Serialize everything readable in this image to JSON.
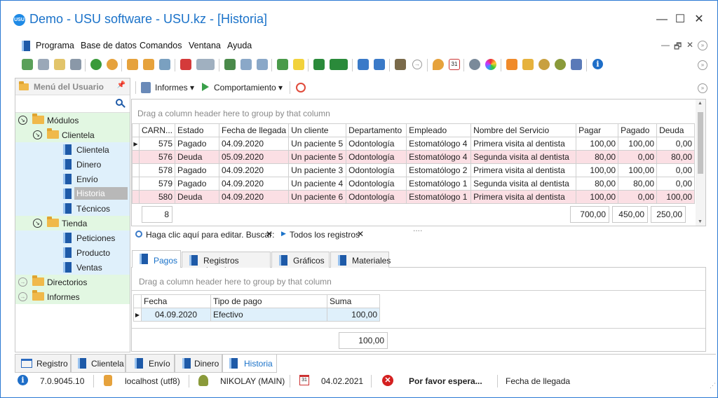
{
  "window": {
    "title": "Demo - USU software - USU.kz - [Historia]",
    "logo_text": "USU",
    "minimize": "—",
    "maximize": "☐",
    "close": "✕"
  },
  "menu": {
    "items": [
      "Programa",
      "Base de datos",
      "Comandos",
      "Ventana",
      "Ayuda"
    ],
    "mdi_controls": [
      "—",
      "🗗",
      "✕"
    ]
  },
  "sidebar": {
    "title": "Menú del Usuario",
    "pin": "📌",
    "tree": [
      {
        "label": "Módulos",
        "level": 0,
        "type": "folder-open"
      },
      {
        "label": "Clientela",
        "level": 1,
        "type": "folder-open"
      },
      {
        "label": "Clientela",
        "level": 2,
        "type": "doc"
      },
      {
        "label": "Dinero",
        "level": 2,
        "type": "doc"
      },
      {
        "label": "Envío",
        "level": 2,
        "type": "doc"
      },
      {
        "label": "Historia",
        "level": 2,
        "type": "doc",
        "selected": true
      },
      {
        "label": "Técnicos",
        "level": 2,
        "type": "doc"
      },
      {
        "label": "Tienda",
        "level": 1,
        "type": "folder-open"
      },
      {
        "label": "Peticiones",
        "level": 2,
        "type": "doc"
      },
      {
        "label": "Producto",
        "level": 2,
        "type": "doc"
      },
      {
        "label": "Ventas",
        "level": 2,
        "type": "doc"
      },
      {
        "label": "Directorios",
        "level": 0,
        "type": "folder"
      },
      {
        "label": "Informes",
        "level": 0,
        "type": "folder"
      }
    ]
  },
  "subtoolbar": {
    "informes": "Informes",
    "comportamiento": "Comportamiento"
  },
  "grid": {
    "group_hint": "Drag a column header here to group by that column",
    "columns": [
      "CARN...",
      "Estado",
      "Fecha de llegada",
      "Un cliente",
      "Departamento",
      "Empleado",
      "Nombre del Servicio",
      "Pagar",
      "Pagado",
      "Deuda"
    ],
    "rows": [
      {
        "carn": "575",
        "estado": "Pagado",
        "fecha": "04.09.2020",
        "cliente": "Un paciente 5",
        "depto": "Odontología",
        "empleado": "Estomatólogo 4",
        "servicio": "Primera visita al dentista",
        "pagar": "100,00",
        "pagado": "100,00",
        "deuda": "0,00",
        "status": "paid"
      },
      {
        "carn": "576",
        "estado": "Deuda",
        "fecha": "05.09.2020",
        "cliente": "Un paciente 5",
        "depto": "Odontología",
        "empleado": "Estomatólogo 4",
        "servicio": "Segunda visita al dentista",
        "pagar": "80,00",
        "pagado": "0,00",
        "deuda": "80,00",
        "status": "debt"
      },
      {
        "carn": "578",
        "estado": "Pagado",
        "fecha": "04.09.2020",
        "cliente": "Un paciente 3",
        "depto": "Odontología",
        "empleado": "Estomatólogo 2",
        "servicio": "Primera visita al dentista",
        "pagar": "100,00",
        "pagado": "100,00",
        "deuda": "0,00",
        "status": "paid"
      },
      {
        "carn": "579",
        "estado": "Pagado",
        "fecha": "04.09.2020",
        "cliente": "Un paciente 4",
        "depto": "Odontología",
        "empleado": "Estomatólogo 1",
        "servicio": "Segunda visita al dentista",
        "pagar": "80,00",
        "pagado": "80,00",
        "deuda": "0,00",
        "status": "paid"
      },
      {
        "carn": "580",
        "estado": "Deuda",
        "fecha": "04.09.2020",
        "cliente": "Un paciente 6",
        "depto": "Odontología",
        "empleado": "Estomatólogo 1",
        "servicio": "Primera visita al dentista",
        "pagar": "100,00",
        "pagado": "0,00",
        "deuda": "100,00",
        "status": "debt"
      }
    ],
    "footer": {
      "count": "8",
      "pagar": "700,00",
      "pagado": "450,00",
      "deuda": "250,00"
    }
  },
  "filter": {
    "edit_hint": "Haga clic aquí para editar. Buscar:",
    "all_records": "Todos los registros"
  },
  "detail_tabs": [
    "Pagos",
    "Registros dentales",
    "Gráficos",
    "Materiales"
  ],
  "detail": {
    "group_hint": "Drag a column header here to group by that column",
    "columns": [
      "Fecha",
      "Tipo de pago",
      "Suma"
    ],
    "rows": [
      {
        "fecha": "04.09.2020",
        "tipo": "Efectivo",
        "suma": "100,00"
      }
    ],
    "total": "100,00"
  },
  "bottom_tabs": [
    "Registro",
    "Clientela",
    "Envío",
    "Dinero",
    "Historia"
  ],
  "status": {
    "version": "7.0.9045.10",
    "server": "localhost (utf8)",
    "user": "NIKOLAY (MAIN)",
    "date": "04.02.2021",
    "calendar_day": "31",
    "message": "Por favor espera...",
    "field": "Fecha de llegada"
  },
  "colors": {
    "accent": "#1a72c9",
    "debt_row": "#fbdfe4",
    "tree_green": "#e2f7e2",
    "tree_blue": "#dff0fb"
  }
}
